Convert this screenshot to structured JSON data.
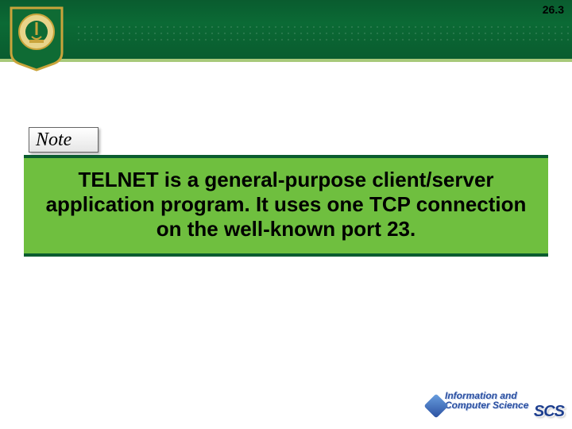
{
  "page_number": "26.3",
  "note": {
    "label": "Note",
    "body": "TELNET is a general-purpose client/server application program. It uses one TCP connection on the well-known port 23."
  },
  "footer": {
    "line1": "Information and",
    "line2": "Computer Science",
    "badge": "SCS"
  }
}
